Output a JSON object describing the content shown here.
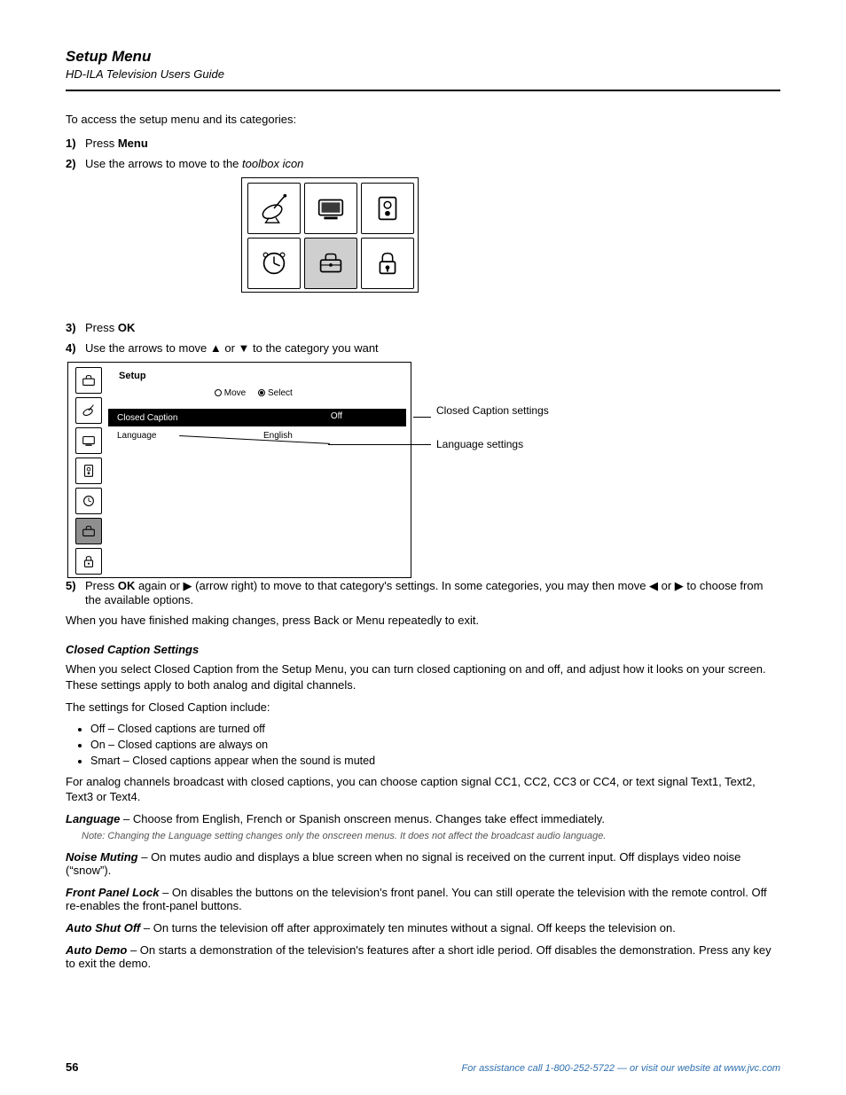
{
  "heading": "Setup Menu",
  "subheading": "HD-ILA Television Users Guide",
  "intro": "To access the setup menu and its categories:",
  "steps": {
    "s1_a": "Press ",
    "s1_key": "Menu",
    "s2_a": "Use the arrows to move to the ",
    "s2_icon": "toolbox icon",
    "s3_a": "Press ",
    "s3_key": "OK",
    "s4_a": "Use the arrows to move ▲ or ▼ to the category you want",
    "s5_a": "Press ",
    "s5_key": "OK",
    "s5_rest": " again or ▶ (arrow right) to move to that category's settings. In some categories, you may then move ◀ or ▶ to choose from the available options.",
    "end": "When you have finished making changes, press Back or Menu repeatedly to exit."
  },
  "grid_alt": {
    "sat": "satellite-dish",
    "tv": "television",
    "spk": "speaker",
    "clk": "clock",
    "tool": "toolbox",
    "lock": "padlock"
  },
  "menu": {
    "title": "Setup",
    "radio_a": "Move",
    "radio_b": "Select",
    "row1_label": "Closed Caption",
    "row1_value": "Off",
    "row2_label": "Language",
    "row2_value": "English"
  },
  "callouts": {
    "c1": "Closed Caption settings",
    "c2": "Language settings"
  },
  "cc": {
    "title": "Closed Caption Settings",
    "p1": "When you select Closed Caption from the Setup Menu, you can turn closed captioning on and off, and adjust how it looks on your screen. These settings apply to both analog and digital channels.",
    "p2": "The settings for Closed Caption include:",
    "opts": [
      "Off – Closed captions are turned off",
      "On – Closed captions are always on",
      "Smart – Closed captions appear when the sound is muted"
    ],
    "p3": "For analog channels broadcast with closed captions, you can choose caption signal CC1, CC2, CC3 or CC4, or text signal Text1, Text2, Text3 or Text4."
  },
  "bullets": {
    "lang_name": "Language",
    "lang_desc": " – Choose from English, French or Spanish onscreen menus. Changes take effect immediately.",
    "note": "Note: Changing the Language setting changes only the onscreen menus. It does not affect the broadcast audio language.",
    "b2_name": "Noise Muting",
    "b2_desc": " – On mutes audio and displays a blue screen when no signal is received on the current input. Off displays video noise (“snow”).",
    "b3_name": "Front Panel Lock",
    "b3_desc": " – On disables the buttons on the television's front panel. You can still operate the television with the remote control. Off re-enables the front-panel buttons.",
    "b4_name": "Auto Shut Off",
    "b4_desc": " – On turns the television off after approximately ten minutes without a signal. Off keeps the television on.",
    "b5_name": "Auto Demo",
    "b5_desc": " – On starts a demonstration of the television's features after a short idle period. Off disables the demonstration. Press any key to exit the demo."
  },
  "page_number": "56",
  "footer": "For assistance call 1-800-252-5722 — or visit our website at www.jvc.com"
}
